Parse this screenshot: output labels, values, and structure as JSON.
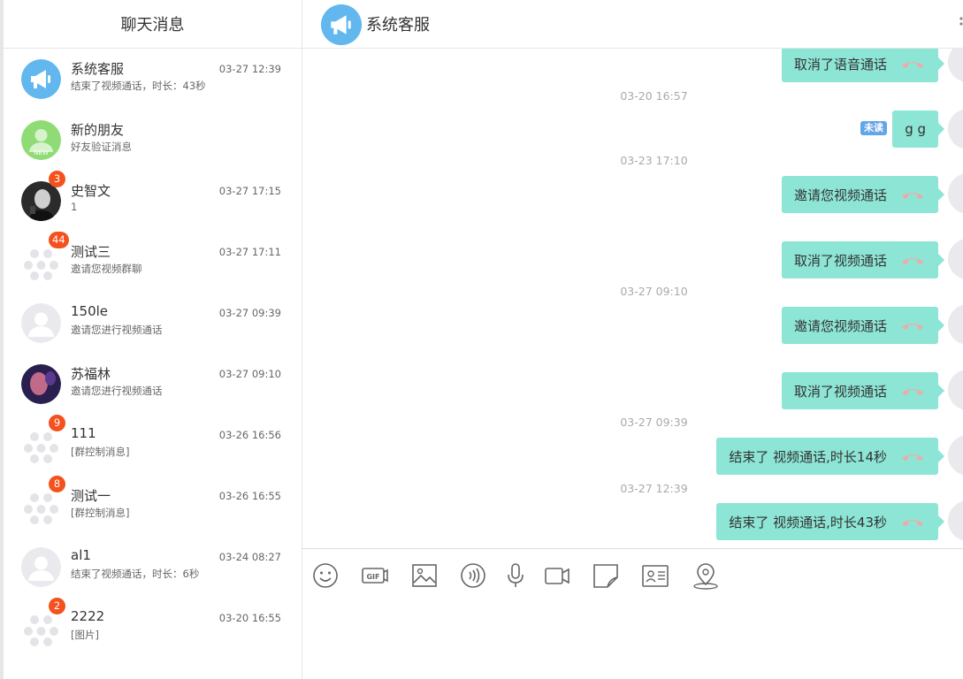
{
  "sidebar": {
    "title": "聊天消息",
    "conversations": [
      {
        "name": "系统客服",
        "preview": "结束了视频通话，时长：43秒",
        "time": "03-27 12:39",
        "badge": "",
        "avatar": "megaphone-icon"
      },
      {
        "name": "新的朋友",
        "preview": "好友验证消息",
        "time": "",
        "badge": "",
        "avatar": "new-friend-icon"
      },
      {
        "name": "史智文",
        "preview": "1",
        "time": "03-27 17:15",
        "badge": "3",
        "avatar": "photo-avatar"
      },
      {
        "name": "测试三",
        "preview": "邀请您视频群聊",
        "time": "03-27 17:11",
        "badge": "44",
        "avatar": "group-avatar"
      },
      {
        "name": "150le",
        "preview": "邀请您进行视频通话",
        "time": "03-27 09:39",
        "badge": "",
        "avatar": "default-avatar"
      },
      {
        "name": "苏福林",
        "preview": "邀请您进行视频通话",
        "time": "03-27 09:10",
        "badge": "",
        "avatar": "photo-avatar"
      },
      {
        "name": "111",
        "preview": "[群控制消息]",
        "time": "03-26 16:56",
        "badge": "9",
        "avatar": "group-avatar"
      },
      {
        "name": "测试一",
        "preview": "[群控制消息]",
        "time": "03-26 16:55",
        "badge": "8",
        "avatar": "group-avatar"
      },
      {
        "name": "al1",
        "preview": "结束了视频通话，时长：6秒",
        "time": "03-24 08:27",
        "badge": "",
        "avatar": "default-avatar"
      },
      {
        "name": "2222",
        "preview": "[图片]",
        "time": "03-20 16:55",
        "badge": "2",
        "avatar": "group-avatar"
      }
    ]
  },
  "chat": {
    "title": "系统客服",
    "avatar_icon": "megaphone-icon",
    "messages": {
      "m1": "取消了语音通话",
      "t1": "03-20 16:57",
      "m2": "g g",
      "unread": "未读",
      "t2": "03-23 17:10",
      "m3": "邀请您视频通话",
      "m4": "取消了视频通话",
      "t3": "03-27 09:10",
      "m5": "邀请您视频通话",
      "m6": "取消了视频通话",
      "t4": "03-27 09:39",
      "m7": "结束了 视频通话,时长14秒",
      "t5": "03-27 12:39",
      "m8": "结束了 视频通话,时长43秒"
    }
  },
  "toolbar": {
    "icons": [
      "emoji-icon",
      "gif-icon",
      "image-icon",
      "voice-call-icon",
      "microphone-icon",
      "video-icon",
      "file-icon",
      "contact-card-icon",
      "location-icon"
    ]
  },
  "colors": {
    "bubble": "#8de5d5",
    "badge": "#f4511e",
    "accent": "#62b7ef"
  }
}
